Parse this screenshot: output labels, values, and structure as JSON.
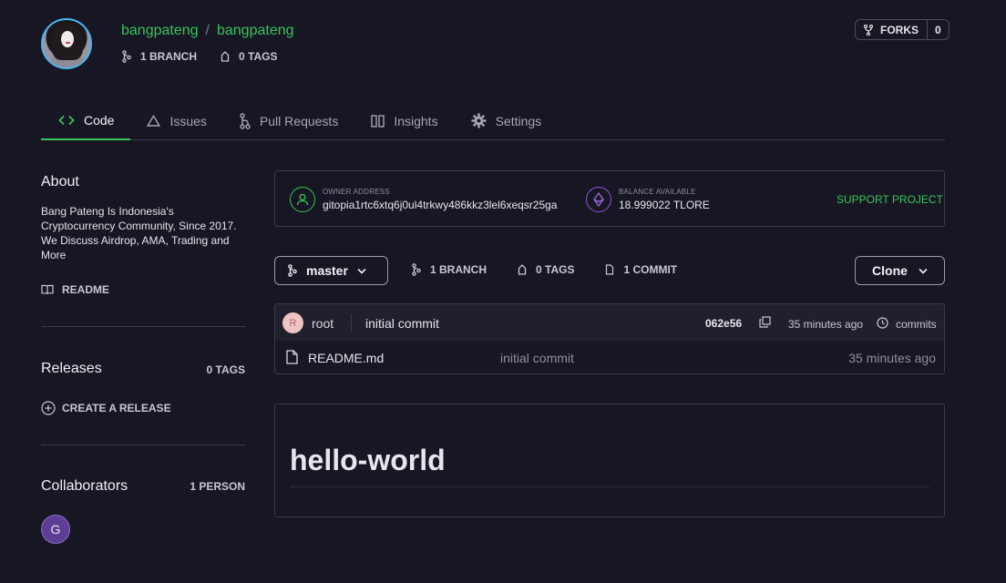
{
  "repo": {
    "owner": "bangpateng",
    "separator": "/",
    "name": "bangpateng",
    "branches": "1 BRANCH",
    "tags": "0 TAGS"
  },
  "forks": {
    "label": "FORKS",
    "count": "0"
  },
  "tabs": [
    {
      "label": "Code",
      "icon": "code-icon",
      "active": true
    },
    {
      "label": "Issues",
      "icon": "issues-icon"
    },
    {
      "label": "Pull Requests",
      "icon": "pull-request-icon"
    },
    {
      "label": "Insights",
      "icon": "insights-icon"
    },
    {
      "label": "Settings",
      "icon": "gear-icon"
    }
  ],
  "about": {
    "heading": "About",
    "description": "Bang Pateng Is Indonesia's Cryptocurrency Community, Since 2017. We Discuss Airdrop, AMA, Trading and More",
    "readme_label": "README"
  },
  "releases": {
    "heading": "Releases",
    "tags": "0 TAGS",
    "create_label": "CREATE A RELEASE"
  },
  "collaborators": {
    "heading": "Collaborators",
    "count": "1 PERSON",
    "avatar_letter": "G"
  },
  "owner": {
    "address_label": "OWNER ADDRESS",
    "address": "gitopia1rtc6xtq6j0ul4trkwy486kkz3lel6xeqsr25ga",
    "balance_label": "BALANCE AVAILABLE",
    "balance": "18.999022 TLORE",
    "support_label": "SUPPORT PROJECT"
  },
  "branch_bar": {
    "branch": "master",
    "branches": "1 BRANCH",
    "tags": "0 TAGS",
    "commits": "1 COMMIT",
    "clone_label": "Clone"
  },
  "commit": {
    "avatar_letter": "R",
    "user": "root",
    "message": "initial commit",
    "hash": "062e56",
    "time": "35 minutes ago",
    "commits_label": "commits"
  },
  "files": [
    {
      "name": "README.md",
      "message": "initial commit",
      "time": "35 minutes ago"
    }
  ],
  "readme": {
    "heading": "hello-world"
  },
  "colors": {
    "accent": "#39c35a",
    "background": "#171723",
    "border": "#3b3b48"
  }
}
